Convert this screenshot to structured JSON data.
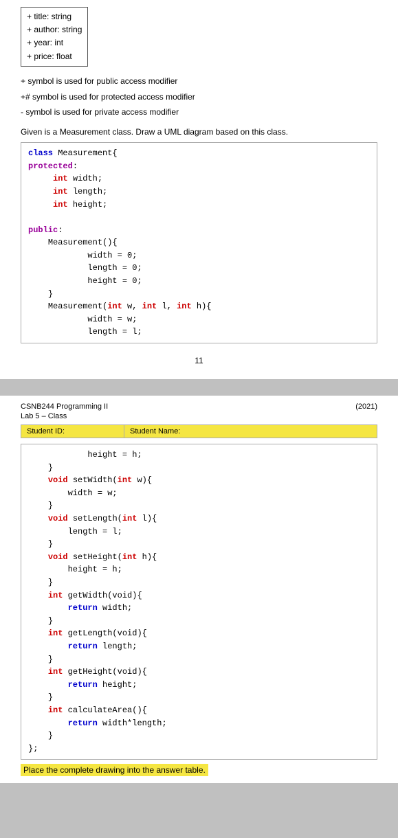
{
  "top": {
    "uml_rows": [
      "+ title: string",
      "+ author: string",
      "+ year: int",
      "+ price: float"
    ],
    "access_legend": [
      "+ symbol is used for public access modifier",
      "+# symbol is used for protected access modifier",
      "- symbol is used for private access modifier"
    ],
    "question": "Given is a Measurement class. Draw a UML diagram based on this class.",
    "page_number": "11"
  },
  "bottom": {
    "course": "CSNB244 Programming II",
    "year": "(2021)",
    "lab": "Lab 5 – Class",
    "student_id_label": "Student ID:",
    "student_name_label": "Student Name:",
    "highlight": "Place the complete drawing into the answer table."
  }
}
